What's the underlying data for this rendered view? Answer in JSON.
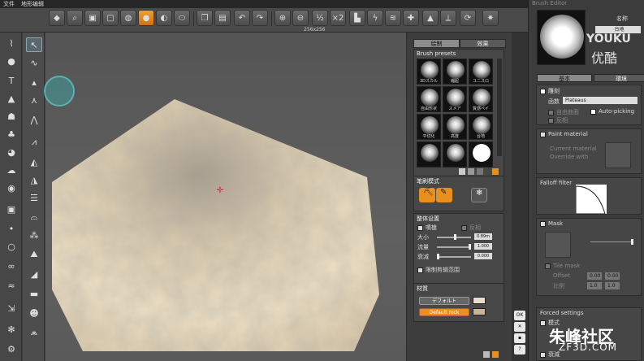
{
  "menubar": {
    "file": "文件",
    "title": "地形编辑"
  },
  "viewport": {
    "size_label": "256x256"
  },
  "brush_tabs": [
    "绘制",
    "效果"
  ],
  "presets": {
    "title": "Brush presets",
    "items": [
      "3Dスカル",
      "縮起",
      "ユニスロ",
      "自由形状",
      "スメア",
      "質感ペイ",
      "平切化",
      "高度",
      "台地",
      ""
    ]
  },
  "brush_mode": {
    "title": "笔刷模式"
  },
  "overall": {
    "title": "整体设置",
    "invert": "噴槍",
    "reverse": "反相",
    "size_label": "大小",
    "size_val": "0.89m",
    "size_level": 0.55,
    "flow_label": "流量",
    "flow_val": "1.000",
    "flow_level": 1.0,
    "falloff_label": "衰减",
    "falloff_val": "0.000",
    "falloff_level": 0.0,
    "limit": "限制剪辑范围"
  },
  "material": {
    "title": "材質",
    "default_btn": "デフォルト",
    "rock_btn": "Default rock",
    "default_color": "#e8ddc8",
    "rock_color": "#c8b496"
  },
  "side": {
    "ok": "OK"
  },
  "editor": {
    "title": "Brush Editor",
    "name_label": "名称",
    "name_value": "台地",
    "tab_basic": "基本",
    "tab_env": "環境",
    "carve": "雕刻",
    "function_label": "函数",
    "function_value": "Plateaus",
    "auto_normal": "自由曲面",
    "auto_picking": "Auto-picking",
    "invert": "反相",
    "paint_material": "Paint material",
    "current_material": "Current material",
    "override_with": "Override with",
    "falloff_filter": "Falloff filter",
    "mask": "Mask",
    "tile_mask": "Tile mask",
    "offset": "Offset",
    "offset_x": "0.00",
    "offset_y": "0.00",
    "scale": "比例",
    "scale_x": "1.0",
    "scale_y": "1.0",
    "forced": "Forced settings",
    "forced_item1": "模式",
    "forced_item2": "衰減"
  },
  "watermarks": {
    "youku": "YOUKU",
    "youku_cn": "优酷",
    "site_cn": "朱峰社区",
    "site_en": "ZF3D.COM"
  },
  "colors": {
    "accent": "#e8901e",
    "terrain": "#e6d8bf",
    "panel": "#3d3d3d"
  }
}
